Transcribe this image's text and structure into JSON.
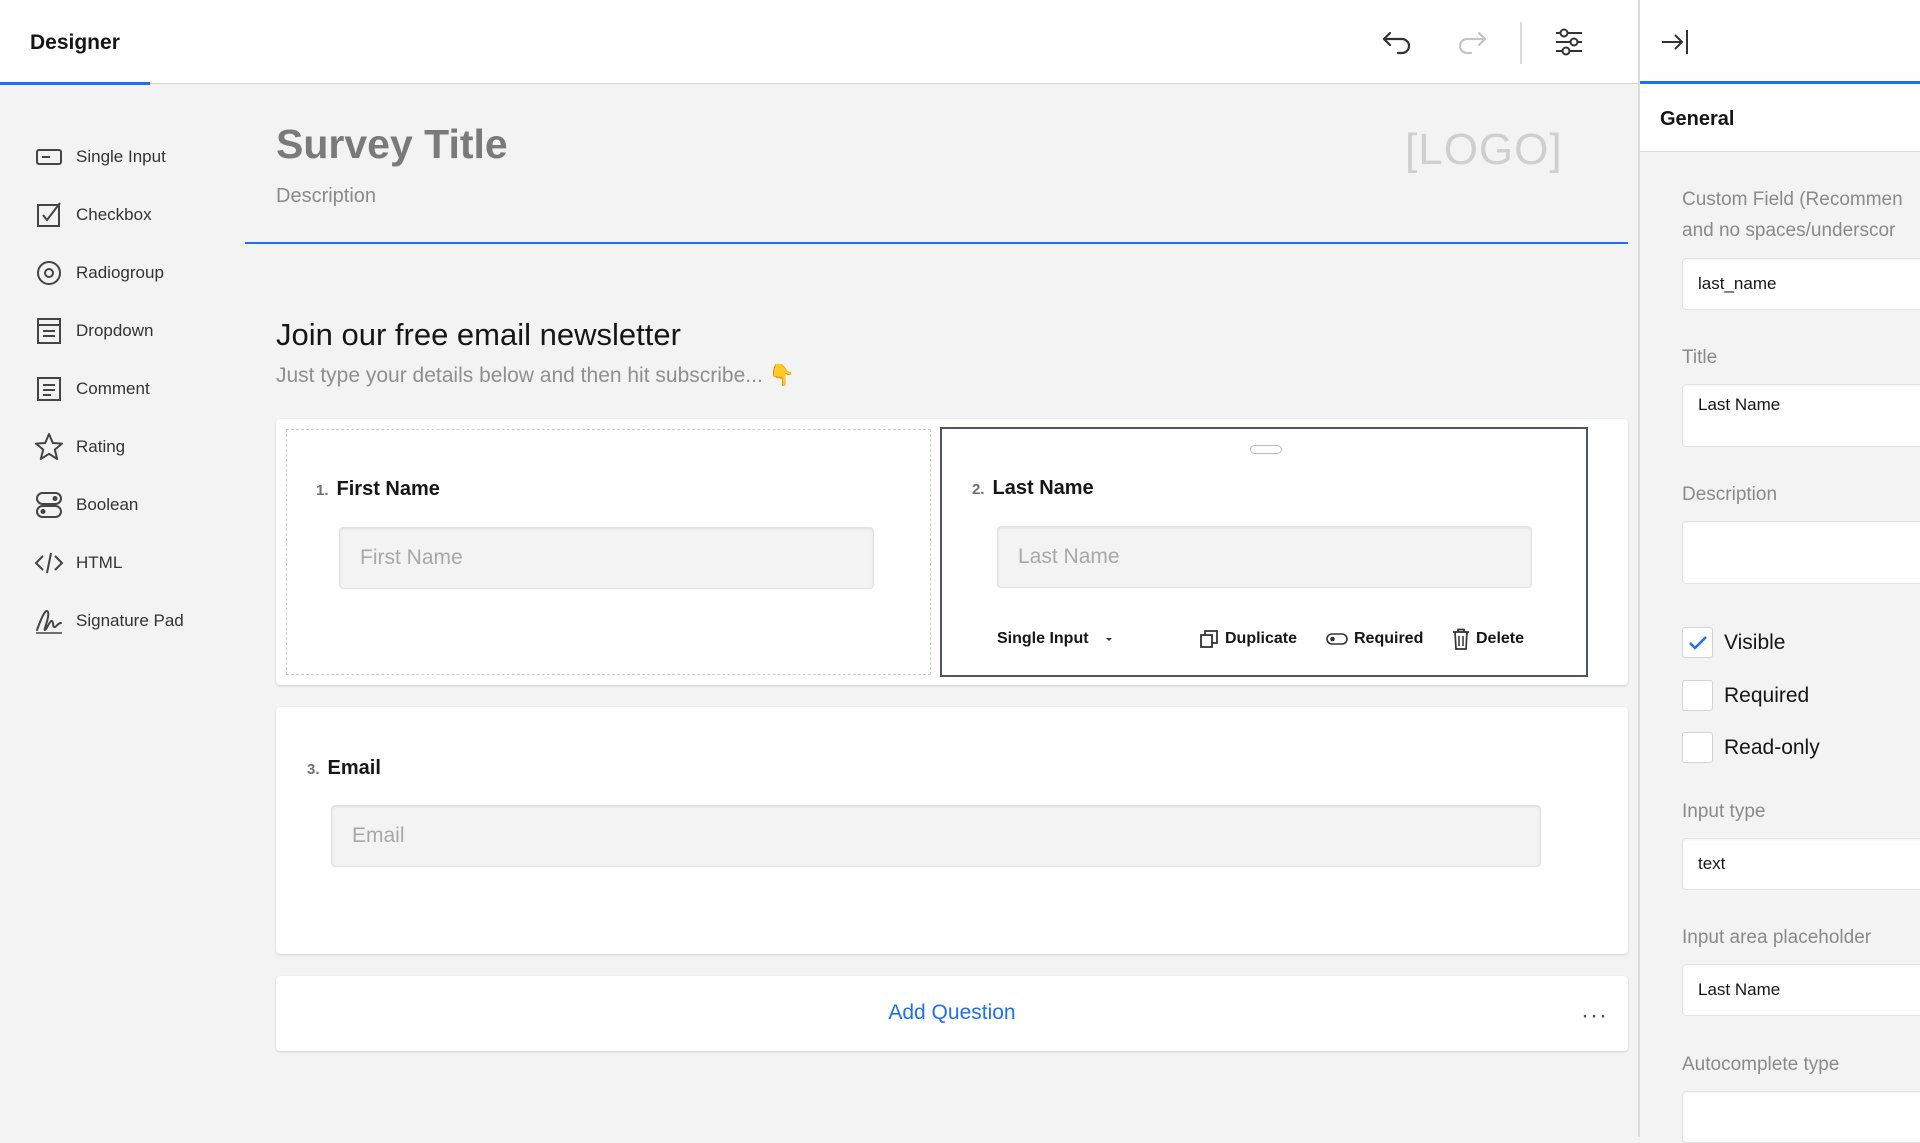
{
  "topbar": {
    "tab_label": "Designer"
  },
  "toolbox": {
    "items": [
      {
        "label": "Single Input",
        "icon": "single-input-icon"
      },
      {
        "label": "Checkbox",
        "icon": "checkbox-icon"
      },
      {
        "label": "Radiogroup",
        "icon": "radiogroup-icon"
      },
      {
        "label": "Dropdown",
        "icon": "dropdown-icon"
      },
      {
        "label": "Comment",
        "icon": "comment-icon"
      },
      {
        "label": "Rating",
        "icon": "star-icon"
      },
      {
        "label": "Boolean",
        "icon": "boolean-icon"
      },
      {
        "label": "HTML",
        "icon": "html-code-icon"
      },
      {
        "label": "Signature Pad",
        "icon": "signature-icon"
      }
    ]
  },
  "survey": {
    "title": "Survey Title",
    "description": "Description",
    "logo": "[LOGO]",
    "page_title": "Join our free email newsletter",
    "page_description": "Just type your details below and then hit subscribe... 👇",
    "questions": [
      {
        "number": "1.",
        "title": "First Name",
        "placeholder": "First Name"
      },
      {
        "number": "2.",
        "title": "Last Name",
        "placeholder": "Last Name"
      },
      {
        "number": "3.",
        "title": "Email",
        "placeholder": "Email"
      }
    ],
    "question_actions": {
      "type": "Single Input",
      "duplicate": "Duplicate",
      "required": "Required",
      "delete": "Delete"
    },
    "add_question": "Add Question",
    "more": "···"
  },
  "properties": {
    "section": "General",
    "custom_field_label_1": "Custom Field (Recommen",
    "custom_field_label_2": "and no spaces/underscor",
    "custom_field_value": "last_name",
    "title_label": "Title",
    "title_value": "Last Name",
    "description_label": "Description",
    "description_value": "",
    "visible_label": "Visible",
    "visible_checked": true,
    "required_label": "Required",
    "required_checked": false,
    "readonly_label": "Read-only",
    "readonly_checked": false,
    "input_type_label": "Input type",
    "input_type_value": "text",
    "placeholder_label": "Input area placeholder",
    "placeholder_value": "Last Name",
    "autocomplete_label": "Autocomplete type",
    "autocomplete_value": ""
  },
  "colors": {
    "accent": "#1f6ff2",
    "selected_border": "#4a5568"
  }
}
